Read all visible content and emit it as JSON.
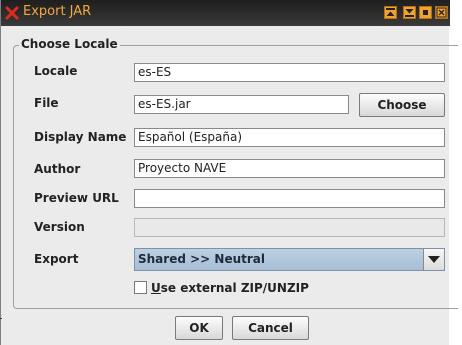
{
  "window": {
    "title": "Export JAR"
  },
  "group": {
    "title": "Choose Locale"
  },
  "fields": {
    "locale": {
      "label": "Locale",
      "value": "es-ES"
    },
    "file": {
      "label": "File",
      "value": "es-ES.jar"
    },
    "display_name": {
      "label": "Display Name",
      "value": "Español (España)"
    },
    "author": {
      "label": "Author",
      "value": "Proyecto NAVE"
    },
    "preview_url": {
      "label": "Preview URL",
      "value": ""
    },
    "version": {
      "label": "Version",
      "value": ""
    },
    "export": {
      "label": "Export",
      "selected": "Shared >> Neutral"
    }
  },
  "buttons": {
    "choose": "Choose",
    "ok": "OK",
    "cancel": "Cancel"
  },
  "checkbox": {
    "mnemonic": "U",
    "rest": "se external ZIP/UNZIP",
    "checked": false
  },
  "colors": {
    "title_text": "#f5a73a",
    "titlebar": "#2a2a2a",
    "combo": "#adc3d9",
    "window_bg": "#ebebeb"
  },
  "icons": {
    "title": "close-x-icon",
    "title_buttons": [
      "shade-up-icon",
      "shade-down-icon",
      "minimize-icon",
      "close-icon"
    ],
    "combo": "chevron-down-icon"
  }
}
